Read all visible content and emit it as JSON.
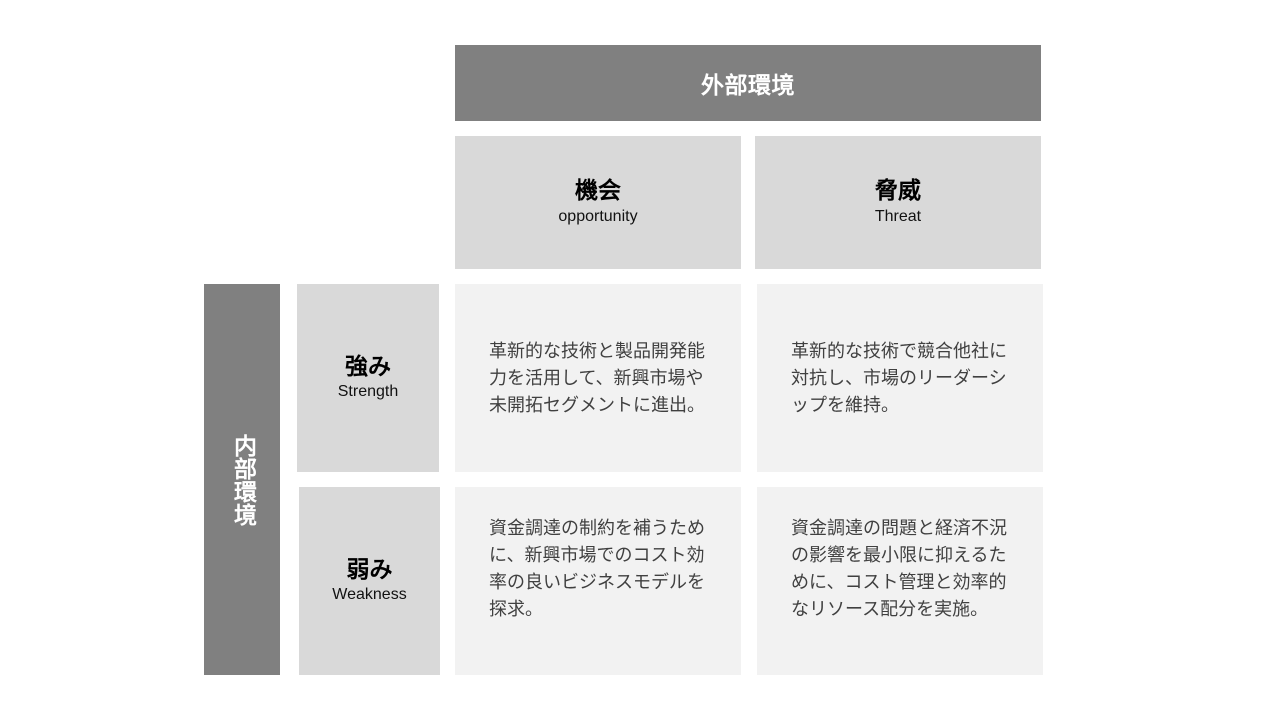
{
  "external": {
    "label": "外部環境"
  },
  "internal": {
    "label": "内部環境"
  },
  "columns": {
    "opportunity": {
      "jp": "機会",
      "en": "opportunity"
    },
    "threat": {
      "jp": "脅威",
      "en": "Threat"
    }
  },
  "rows": {
    "strength": {
      "jp": "強み",
      "en": "Strength"
    },
    "weakness": {
      "jp": "弱み",
      "en": "Weakness"
    }
  },
  "cells": {
    "strength_opportunity": "革新的な技術と製品開発能力を活用して、新興市場や未開拓セグメントに進出。",
    "strength_threat": "革新的な技術で競合他社に対抗し、市場のリーダーシップを維持。",
    "weakness_opportunity": "資金調達の制約を補うために、新興市場でのコスト効率の良いビジネスモデルを探求。",
    "weakness_threat": "資金調達の問題と経済不況の影響を最小限に抑えるために、コスト管理と効率的なリソース配分を実施。"
  }
}
